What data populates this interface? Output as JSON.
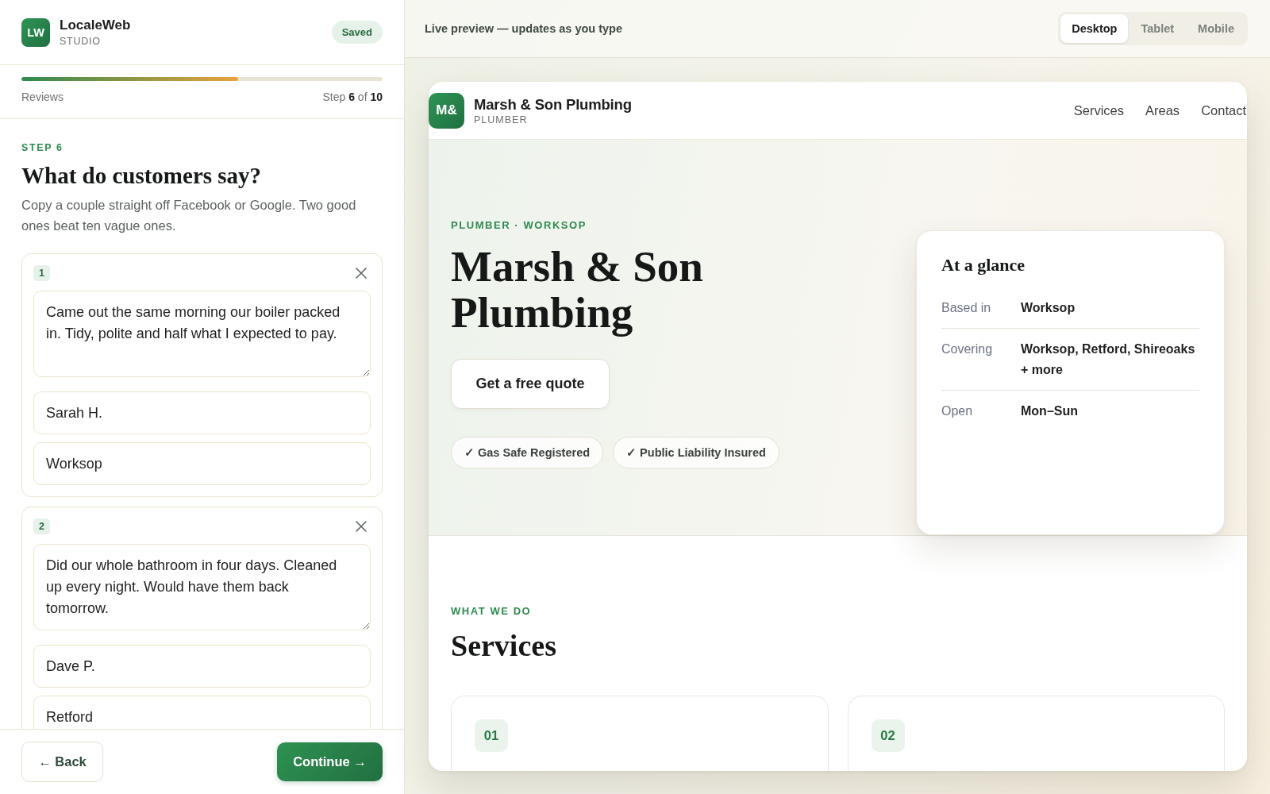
{
  "app": {
    "logo": "LW",
    "name": "LocaleWeb",
    "subtitle": "STUDIO",
    "status": "Saved"
  },
  "progress": {
    "level": 0.6,
    "section": "Reviews",
    "counter": "Step **6** of **10**"
  },
  "step": {
    "eyebrow": "STEP 6",
    "title": "What do customers say?",
    "description": "Copy a couple straight off Facebook or Google. Two good ones beat ten vague ones."
  },
  "reviews": [
    {
      "number": "1",
      "quote": "Came out the same morning our boiler packed in. Tidy, polite and half what I expected to pay.",
      "name": "Sarah H.",
      "location": "Worksop"
    },
    {
      "number": "2",
      "quote": "Did our whole bathroom in four days. Cleaned up every night. Would have them back tomorrow.",
      "name": "Dave P.",
      "location": "Retford"
    }
  ],
  "footer": {
    "back": "← Back",
    "continue": "Continue →"
  },
  "preview_bar": {
    "caption": "Live preview — updates as you type",
    "devices": [
      {
        "label": "Desktop",
        "selected": true
      },
      {
        "label": "Tablet",
        "selected": false
      },
      {
        "label": "Mobile",
        "selected": false
      }
    ]
  },
  "site": {
    "nav": {
      "logo": "M&",
      "name": "Marsh & Son Plumbing",
      "trade": "PLUMBER",
      "links": [
        "Services",
        "Areas",
        "Contact"
      ]
    },
    "hero": {
      "eyebrow": "PLUMBER · WORKSOP",
      "title": "Marsh & Son Plumbing",
      "cta": "Get a free quote",
      "badges": [
        "✓ Gas Safe Registered",
        "✓ Public Liability Insured"
      ]
    },
    "glance": {
      "title": "At a glance",
      "rows": [
        {
          "label": "Based in",
          "value": "Worksop"
        },
        {
          "label": "Covering",
          "value": "Worksop, Retford, Shireoaks + more"
        },
        {
          "label": "Open",
          "value": "Mon–Sun"
        }
      ]
    },
    "services": {
      "eyebrow": "WHAT WE DO",
      "title": "Services",
      "cards": [
        {
          "number": "01"
        },
        {
          "number": "02"
        }
      ]
    }
  }
}
